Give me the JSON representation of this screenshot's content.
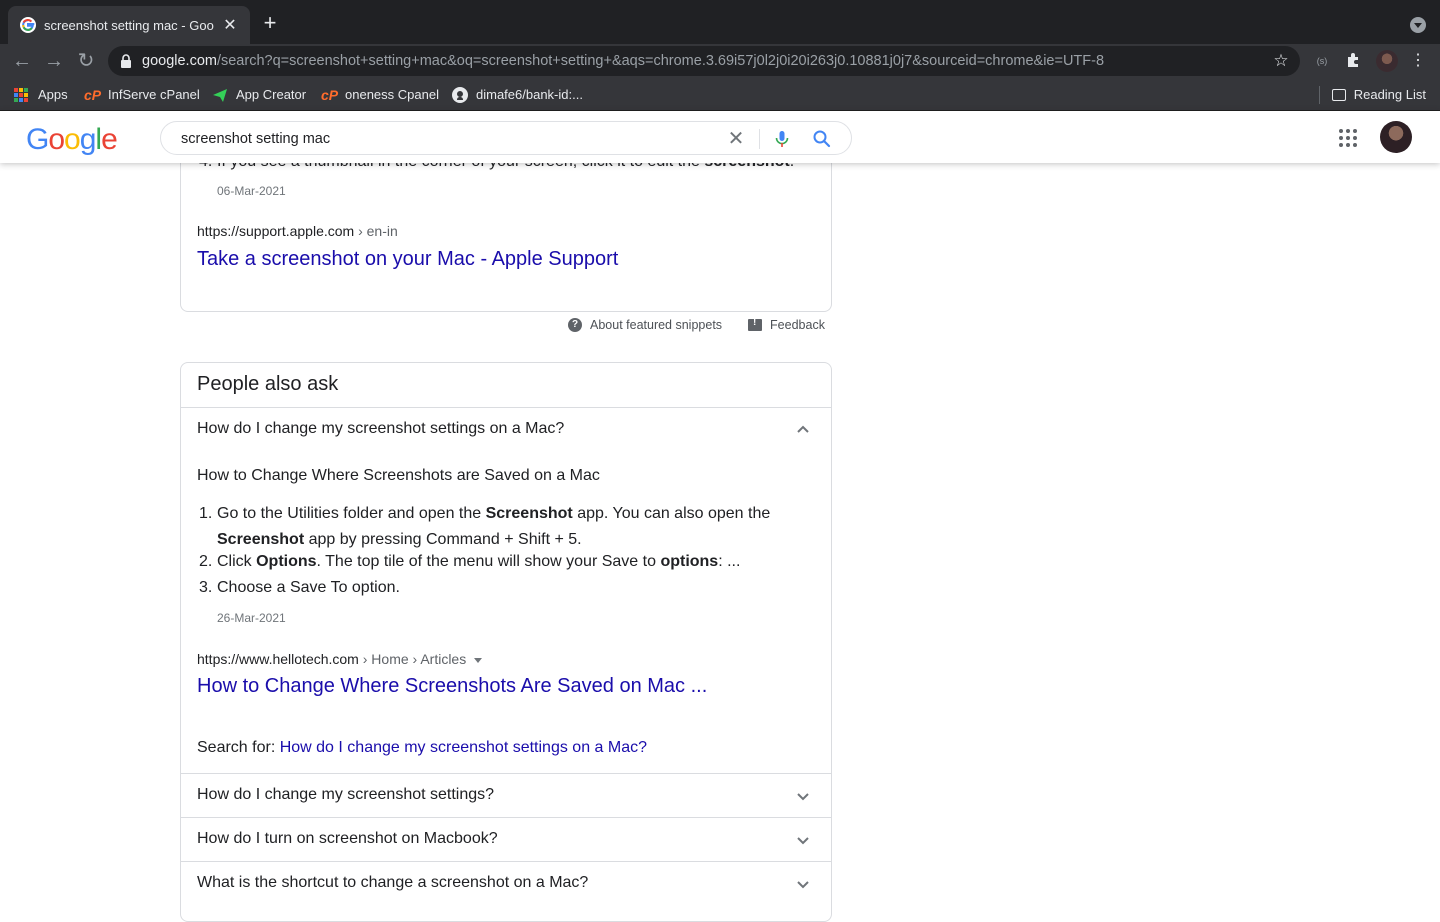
{
  "browser": {
    "tab_title": "screenshot setting mac - Google Search",
    "url_domain": "google.com",
    "url_path": "/search?q=screenshot+setting+mac&oq=screenshot+setting+&aqs=chrome.3.69i57j0l2j0i20i263j0.10881j0j7&sourceid=chrome&ie=UTF-8",
    "bookmarks": [
      {
        "label": "Apps",
        "icon": "apps-grid-icon"
      },
      {
        "label": "InfServe cPanel",
        "icon": "cpanel-icon"
      },
      {
        "label": "App Creator",
        "icon": "paper-plane-icon"
      },
      {
        "label": "oneness Cpanel",
        "icon": "cpanel-icon"
      },
      {
        "label": "dimafe6/bank-id:...",
        "icon": "github-icon"
      }
    ],
    "reading_list": "Reading List"
  },
  "search": {
    "query": "screenshot setting mac"
  },
  "snippet": {
    "step4_prefix": "If you see a thumbnail in the corner of your screen, click it to edit the",
    "step4_bold": "screenshot",
    "step4_suffix": ".",
    "date": "06-Mar-2021",
    "cite_url": "https://support.apple.com",
    "cite_crumb": " › en-in",
    "title": "Take a screenshot on your Mac - Apple Support",
    "about": "About featured snippets",
    "feedback": "Feedback"
  },
  "paa": {
    "heading": "People also ask",
    "expanded": {
      "question": "How do I change my screenshot settings on a Mac?",
      "answer_heading": "How to Change Where Screenshots are Saved on a Mac",
      "step1_a": "Go to the Utilities folder and open the ",
      "step1_b": "Screenshot",
      "step1_c": " app. You can also open the",
      "step1_d": "Screenshot",
      "step1_e": " app by pressing Command + Shift + 5.",
      "step2_a": "Click ",
      "step2_b": "Options",
      "step2_c": ". The top tile of the menu will show your Save to ",
      "step2_d": "options",
      "step2_e": ": ...",
      "step3": "Choose a Save To option.",
      "date": "26-Mar-2021",
      "cite_url": "https://www.hellotech.com",
      "cite_crumb": " › Home › Articles",
      "title": "How to Change Where Screenshots Are Saved on Mac ...",
      "search_for_label": "Search for: ",
      "search_for_link": "How do I change my screenshot settings on a Mac?"
    },
    "questions": [
      "How do I change my screenshot settings?",
      "How do I turn on screenshot on Macbook?",
      "What is the shortcut to change a screenshot on a Mac?"
    ]
  },
  "colors": {
    "link": "#1a0dab",
    "chrome_dark": "#202124",
    "chrome_toolbar": "#35363a"
  }
}
